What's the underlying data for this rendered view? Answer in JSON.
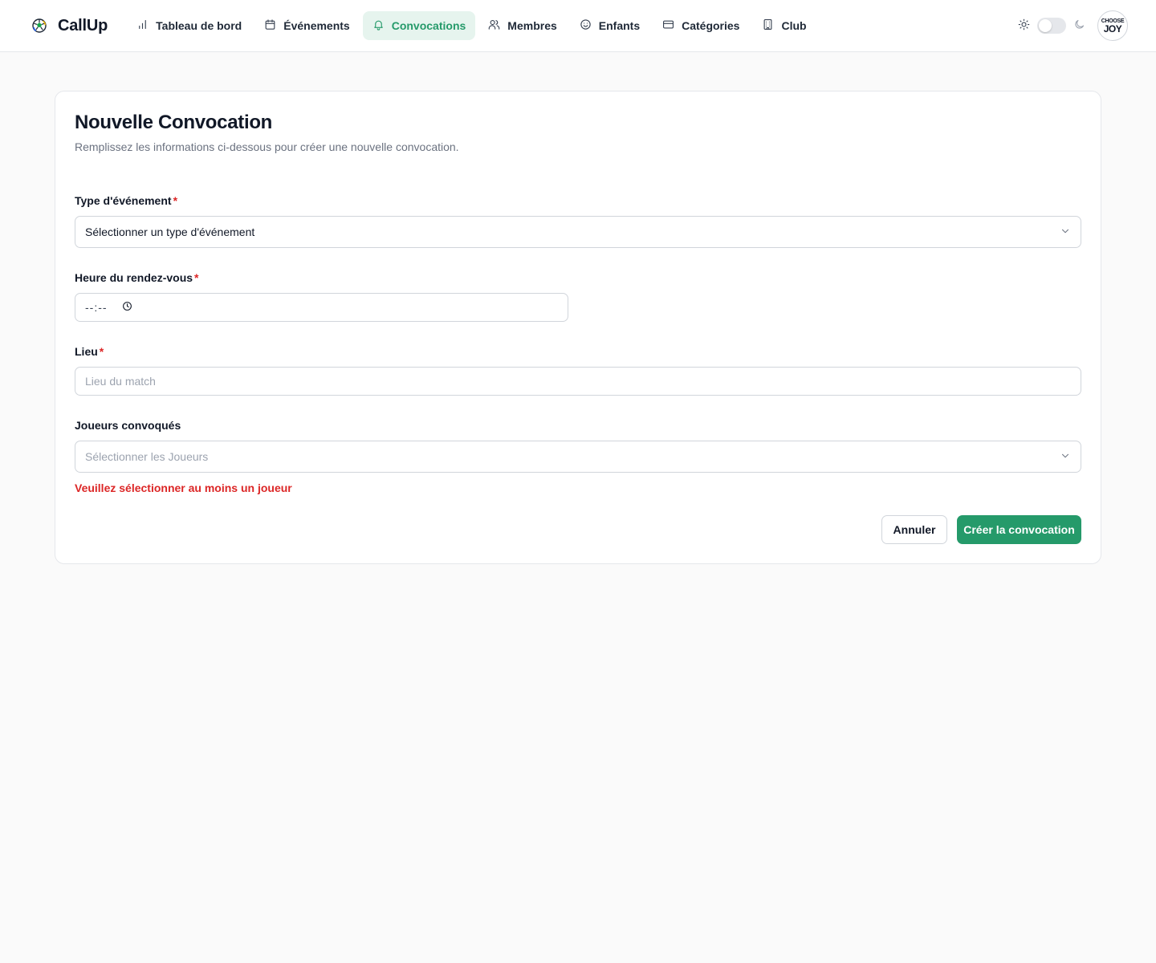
{
  "app": {
    "name": "CallUp"
  },
  "nav": {
    "items": [
      {
        "label": "Tableau de bord",
        "icon": "bar-chart-icon"
      },
      {
        "label": "Événements",
        "icon": "calendar-icon"
      },
      {
        "label": "Convocations",
        "icon": "bell-icon",
        "active": true
      },
      {
        "label": "Membres",
        "icon": "users-icon"
      },
      {
        "label": "Enfants",
        "icon": "smile-icon"
      },
      {
        "label": "Catégories",
        "icon": "credit-card-icon"
      },
      {
        "label": "Club",
        "icon": "building-icon"
      }
    ]
  },
  "theme": {
    "mode": "light"
  },
  "avatar": {
    "line1": "CHOOSE",
    "line2": "JOY"
  },
  "form": {
    "title": "Nouvelle Convocation",
    "subtitle": "Remplissez les informations ci-dessous pour créer une nouvelle convocation.",
    "event_type": {
      "label": "Type d'événement",
      "required_mark": "*",
      "value": "Sélectionner un type d'événement"
    },
    "meeting_time": {
      "label": "Heure du rendez-vous",
      "required_mark": "*",
      "value": "--:--"
    },
    "location": {
      "label": "Lieu",
      "required_mark": "*",
      "placeholder": "Lieu du match"
    },
    "players": {
      "label": "Joueurs convoqués",
      "placeholder": "Sélectionner les Joueurs",
      "error": "Veuillez sélectionner au moins un joueur"
    },
    "cancel_label": "Annuler",
    "submit_label": "Créer la convocation"
  },
  "colors": {
    "accent": "#259a6a",
    "accent_bg": "#e6f4ee",
    "error": "#dc2626"
  }
}
